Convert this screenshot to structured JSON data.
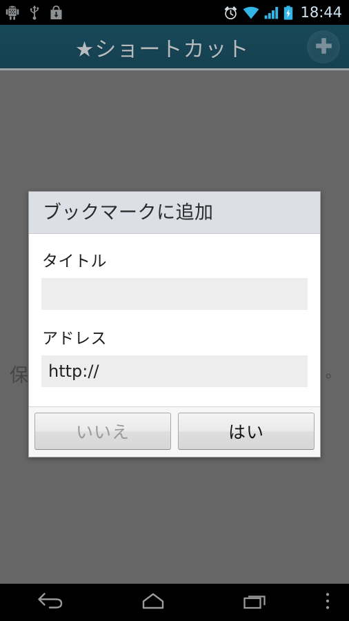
{
  "status_bar": {
    "left_icons": [
      {
        "name": "android-debug-icon",
        "glyph": "android"
      },
      {
        "name": "usb-icon",
        "glyph": "usb"
      },
      {
        "name": "download-icon",
        "glyph": "download-bag"
      }
    ],
    "right_icons": [
      {
        "name": "alarm-clock-icon",
        "glyph": "alarm"
      },
      {
        "name": "wifi-icon",
        "glyph": "wifi"
      },
      {
        "name": "signal-icon",
        "glyph": "signal-bars"
      },
      {
        "name": "battery-charging-icon",
        "glyph": "battery-bolt"
      }
    ],
    "clock": "18:44",
    "background_color": "#000000",
    "clock_color": "#cfe6f2",
    "icon_accent_color": "#33b5e5"
  },
  "action_bar": {
    "title": "★ショートカット",
    "background_color": "#164453",
    "title_color": "#b6bcbe",
    "add_button": {
      "name": "add-button",
      "icon": "plus-icon",
      "label": "+"
    }
  },
  "background": {
    "dim_color": "#666666",
    "partial_text_left": "保",
    "partial_text_right": "。"
  },
  "dialog": {
    "title": "ブックマークに追加",
    "header_color": "#dcdfe5",
    "fields": [
      {
        "name": "title-field",
        "label": "タイトル",
        "value": "",
        "placeholder": ""
      },
      {
        "name": "address-field",
        "label": "アドレス",
        "value": "http://",
        "placeholder": ""
      }
    ],
    "buttons": [
      {
        "name": "no-button",
        "label": "いいえ",
        "state": "disabled"
      },
      {
        "name": "yes-button",
        "label": "はい",
        "state": "enabled"
      }
    ]
  },
  "nav_bar": {
    "background_color": "#000000",
    "buttons": [
      {
        "name": "nav-back-button",
        "icon": "back-arrow-icon"
      },
      {
        "name": "nav-home-button",
        "icon": "home-icon"
      },
      {
        "name": "nav-recents-button",
        "icon": "recents-icon"
      },
      {
        "name": "nav-overflow-button",
        "icon": "overflow-menu-icon"
      }
    ]
  }
}
